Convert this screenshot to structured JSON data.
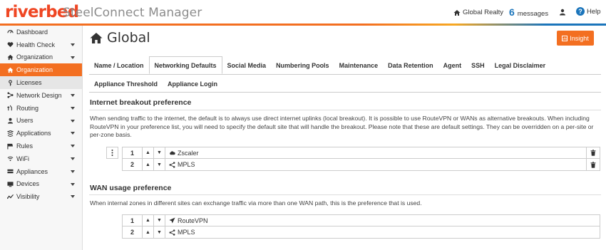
{
  "header": {
    "logo": "riverbed",
    "app_title": "SteelConnect Manager",
    "org_name": "Global Realty",
    "messages_count": "6",
    "messages_label": "messages",
    "help_label": "Help"
  },
  "sidebar": {
    "items": [
      {
        "label": "Dashboard",
        "icon": "dashboard-icon"
      },
      {
        "label": "Health Check",
        "icon": "heart-icon"
      },
      {
        "label": "Organization",
        "icon": "home-icon"
      },
      {
        "label": "Organization",
        "icon": "home-icon"
      },
      {
        "label": "Licenses",
        "icon": "key-icon"
      },
      {
        "label": "Network Design",
        "icon": "network-icon"
      },
      {
        "label": "Routing",
        "icon": "routing-icon"
      },
      {
        "label": "Users",
        "icon": "user-icon"
      },
      {
        "label": "Applications",
        "icon": "applications-icon"
      },
      {
        "label": "Rules",
        "icon": "rules-icon"
      },
      {
        "label": "WiFi",
        "icon": "wifi-icon"
      },
      {
        "label": "Appliances",
        "icon": "appliances-icon"
      },
      {
        "label": "Devices",
        "icon": "devices-icon"
      },
      {
        "label": "Visibility",
        "icon": "visibility-icon"
      }
    ]
  },
  "page": {
    "title": "Global",
    "insight_label": "Insight"
  },
  "tabs": {
    "row1": [
      "Name / Location",
      "Networking Defaults",
      "Social Media",
      "Numbering Pools",
      "Maintenance",
      "Data Retention",
      "Agent",
      "SSH",
      "Legal Disclaimer"
    ],
    "row2": [
      "Appliance Threshold",
      "Appliance Login"
    ],
    "active": "Networking Defaults"
  },
  "breakout": {
    "title": "Internet breakout preference",
    "description": "When sending traffic to the internet, the default is to always use direct internet uplinks (local breakout). It is possible to use RouteVPN or WANs as alternative breakouts. When including RouteVPN in your preference list, you will need to specify the default site that will handle the breakout. Please note that these are default settings. They can be overridden on a per-site or per-zone basis.",
    "rows": [
      {
        "num": "1",
        "name": "Zscaler",
        "icon": "cloud-icon"
      },
      {
        "num": "2",
        "name": "MPLS",
        "icon": "share-icon"
      }
    ]
  },
  "wan": {
    "title": "WAN usage preference",
    "description": "When internal zones in different sites can exchange traffic via more than one WAN path, this is the preference that is used.",
    "rows": [
      {
        "num": "1",
        "name": "RouteVPN",
        "icon": "send-icon"
      },
      {
        "num": "2",
        "name": "MPLS",
        "icon": "share-icon"
      }
    ]
  },
  "colors": {
    "brand": "#ef4623",
    "accent": "#f36f21",
    "link": "#1b75bb"
  }
}
